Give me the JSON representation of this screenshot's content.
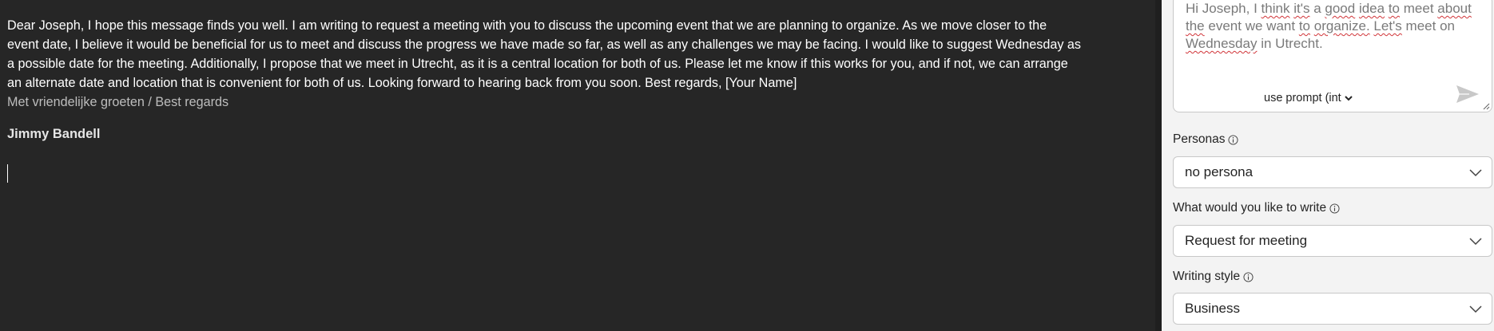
{
  "editor": {
    "body_lines": [
      "Dear Joseph, I hope this message finds you well. I am writing to request a meeting with you to discuss the upcoming event that we are planning to organize. As we move closer to the",
      "event date, I believe it would be beneficial for us to meet and discuss the progress we have made so far, as well as any challenges we may be facing. I would like to suggest Wednesday as",
      "a possible date for the meeting. Additionally, I propose that we meet in Utrecht, as it is a central location for both of us. Please let me know if this works for you, and if not, we can arrange",
      "an alternate date and location that is convenient for both of us. Looking forward to hearing back from you soon. Best regards, [Your Name]"
    ],
    "signoff": "Met vriendelijke groeten / Best regards",
    "signature": "Jimmy Bandell"
  },
  "panel": {
    "prompt_words": [
      "Hi",
      "Joseph,",
      "I",
      "think",
      "it's",
      "a",
      "good",
      "idea",
      "to",
      "meet",
      "about",
      "the",
      "event",
      "we",
      "want",
      "to",
      "organize.",
      "Let's",
      "meet",
      "on",
      "Wednesday",
      "in",
      "Utrecht."
    ],
    "use_prompt_label": "use prompt (int",
    "personas_label": "Personas",
    "personas_value": "no persona",
    "write_label": "What would you like to write",
    "write_value": "Request for meeting",
    "style_label": "Writing style",
    "style_value": "Business"
  },
  "colors": {
    "editor_bg": "#262626",
    "panel_bg": "#f3f3f3",
    "spell_error": "#d13438"
  },
  "icons": {
    "send": "send-icon",
    "chevron": "chevron-down-icon",
    "info": "info-icon"
  }
}
